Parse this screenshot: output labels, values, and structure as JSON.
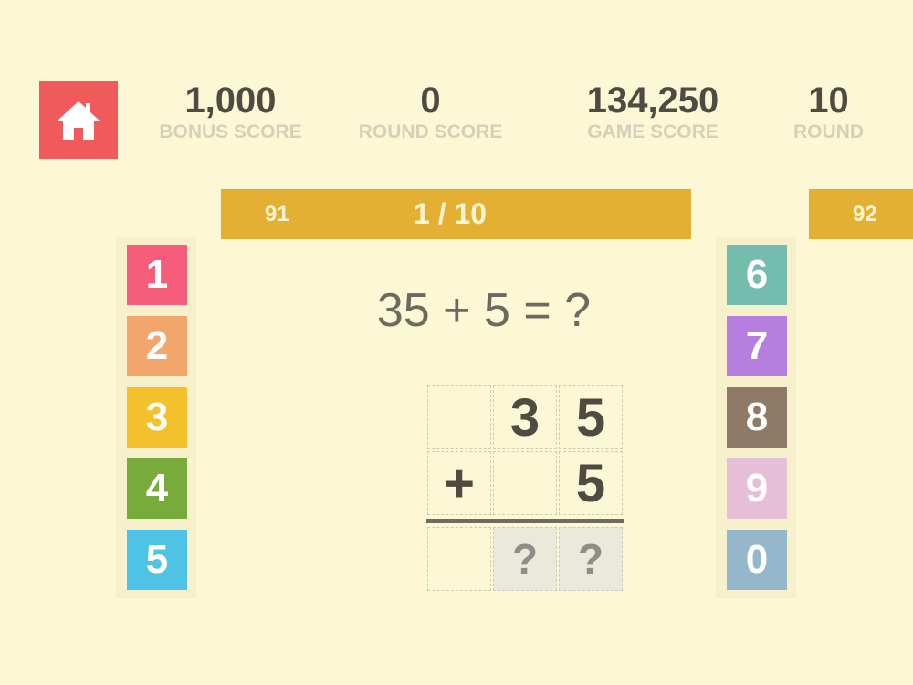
{
  "header": {
    "home_icon": "home-icon",
    "stats": [
      {
        "value": "1,000",
        "label": "BONUS SCORE"
      },
      {
        "value": "0",
        "label": "ROUND SCORE"
      },
      {
        "value": "134,250",
        "label": "GAME SCORE"
      },
      {
        "value": "10",
        "label": "ROUND"
      }
    ]
  },
  "problem_bar": {
    "prev_number": "91",
    "progress": "1 / 10",
    "next_number": "92"
  },
  "equation": "35 + 5 = ?",
  "keypad_left": [
    {
      "label": "1",
      "color": "#f55d7a"
    },
    {
      "label": "2",
      "color": "#f2a66c"
    },
    {
      "label": "3",
      "color": "#f3c12c"
    },
    {
      "label": "4",
      "color": "#77ab3b"
    },
    {
      "label": "5",
      "color": "#4fc3e6"
    }
  ],
  "keypad_right": [
    {
      "label": "6",
      "color": "#73bcae"
    },
    {
      "label": "7",
      "color": "#b47fde"
    },
    {
      "label": "8",
      "color": "#8e7a66"
    },
    {
      "label": "9",
      "color": "#e5bed8"
    },
    {
      "label": "0",
      "color": "#94b7cb"
    }
  ],
  "worksheet": {
    "row1": [
      "",
      "3",
      "5"
    ],
    "row2": [
      "+",
      "",
      "5"
    ],
    "answer": [
      "",
      "?",
      "?"
    ]
  }
}
